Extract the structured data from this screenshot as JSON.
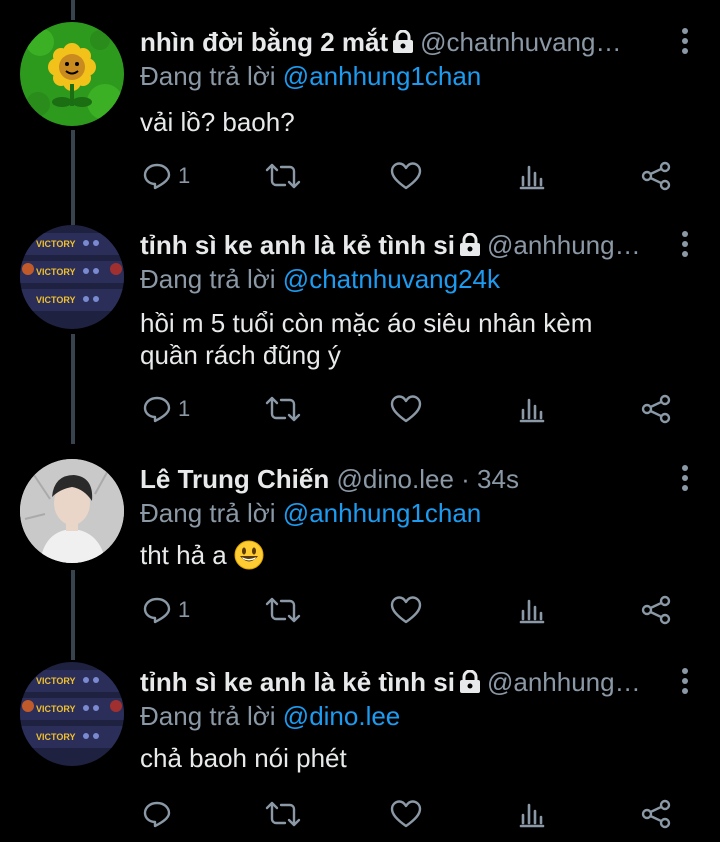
{
  "tweets": [
    {
      "name": "nhìn đời bằng 2 mắt",
      "handle": "@chatnhuvang…",
      "reply_prefix": "Đang trả lời",
      "reply_mention": "@anhhung1chan",
      "text": "vải lồ? baoh?",
      "reply_count": "1",
      "avatar": "sunflower-avatar"
    },
    {
      "name": "tỉnh sì ke anh là kẻ tình si",
      "handle": "@anhhung…",
      "reply_prefix": "Đang trả lời",
      "reply_mention": "@chatnhuvang24k",
      "text_line1": "hồi m 5 tuổi còn mặc áo siêu nhân kèm",
      "text_line2": "quần rách đũng ý",
      "reply_count": "1",
      "avatar_label": "VICTORY"
    },
    {
      "name": "Lê Trung Chiến",
      "handle": "@dino.lee · 34s",
      "reply_prefix": "Đang trả lời",
      "reply_mention": "@anhhung1chan",
      "text": "tht hả a",
      "reply_count": "1",
      "avatar": "person-photo-avatar"
    },
    {
      "name": "tỉnh sì ke anh là kẻ tình si",
      "handle": "@anhhung…",
      "reply_prefix": "Đang trả lời",
      "reply_mention": "@dino.lee",
      "text": "chả baoh nói phét",
      "reply_count": "",
      "avatar_label": "VICTORY"
    }
  ],
  "colors": {
    "accent": "#1d9bf0",
    "muted": "#8b98a5",
    "background": "#000000"
  },
  "icons": [
    "reply-icon",
    "retweet-icon",
    "like-icon",
    "analytics-icon",
    "share-icon",
    "lock-icon",
    "more-icon"
  ]
}
